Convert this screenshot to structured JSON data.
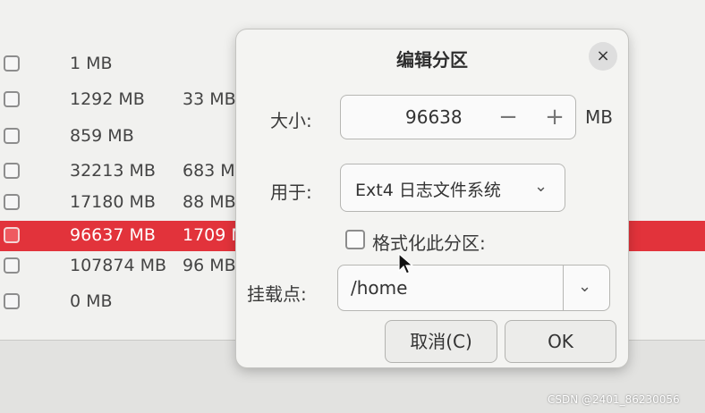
{
  "partitions": [
    {
      "size": "1 MB",
      "used": ""
    },
    {
      "size": "1292 MB",
      "used": "33 MB"
    },
    {
      "size": "859 MB",
      "used": ""
    },
    {
      "size": "32213 MB",
      "used": "683 MB"
    },
    {
      "size": "17180 MB",
      "used": "88 MB"
    },
    {
      "size": "96637 MB",
      "used": "1709 M",
      "selected": true
    },
    {
      "size": "107874 MB",
      "used": "96 MB"
    },
    {
      "size": "0 MB",
      "used": ""
    }
  ],
  "dialog": {
    "title": "编辑分区",
    "close_icon": "×",
    "size_label": "大小:",
    "size_value": "96638",
    "minus_label": "−",
    "plus_label": "+",
    "size_unit": "MB",
    "use_as_label": "用于:",
    "filesystem_value": "Ext4 日志文件系统",
    "chevron_icon": "⌄",
    "format_label": "格式化此分区:",
    "format_checked": false,
    "mount_label": "挂载点:",
    "mount_value": "/home",
    "cancel_label": "取消(C)",
    "ok_label": "OK"
  },
  "watermark": "CSDN @2401_86230056",
  "colors": {
    "selected_row": "#e2333b",
    "dialog_bg": "#f4f4f2"
  }
}
